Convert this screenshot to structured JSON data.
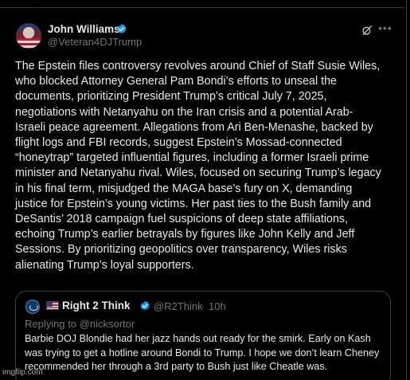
{
  "tweet": {
    "author": {
      "name": "John Williams",
      "handle": "@Veteran4DJTrump"
    },
    "text": "The Epstein files controversy revolves around Chief of Staff Susie Wiles,\nwho blocked Attorney General Pam Bondi’s efforts to unseal the\ndocuments, prioritizing President Trump’s critical July 7, 2025,\nnegotiations with Netanyahu on the Iran crisis and a potential Arab-\nIsraeli peace agreement. Allegations from Ari Ben-Menashe, backed by\nflight logs and FBI records, suggest Epstein’s Mossad-connected\n“honeytrap” targeted influential figures, including a former Israeli prime\nminister and Netanyahu rival. Wiles, focused on securing Trump’s legacy\nin his final term, misjudged the MAGA base’s fury on X, demanding\njustice for Epstein’s young victims. Her past ties to the Bush family and\nDeSantis’ 2018 campaign fuel suspicions of deep state affiliations,\nechoing Trump’s earlier betrayals by figures like John Kelly and Jeff\nSessions. By prioritizing geopolitics over transparency, Wiles risks\nalienating Trump’s loyal supporters."
  },
  "quote": {
    "author_name": "Right 2 Think",
    "handle": "@R2Think",
    "separator": "·",
    "time": "10h",
    "reply_prefix": "Replying to ",
    "reply_to": "@nicksortor",
    "text": "Barbie DOJ Blondie had her jazz hands out ready for the smirk. Early on Kash was trying to get a hotline around Bondi to Trump. I hope we don’t learn Cheney recommended her through a 3rd party to Bush just like Cheatle was."
  },
  "icons": {
    "verified": "verified-badge-icon",
    "grok": "grok-icon",
    "more": "more-options-icon",
    "flag": "us-flag-icon"
  },
  "colors": {
    "background": "#000000",
    "text": "#e7e9ea",
    "muted": "#71767b",
    "verified": "#1d9bf0",
    "border": "#2f3336"
  },
  "watermark": "imgflip.com"
}
